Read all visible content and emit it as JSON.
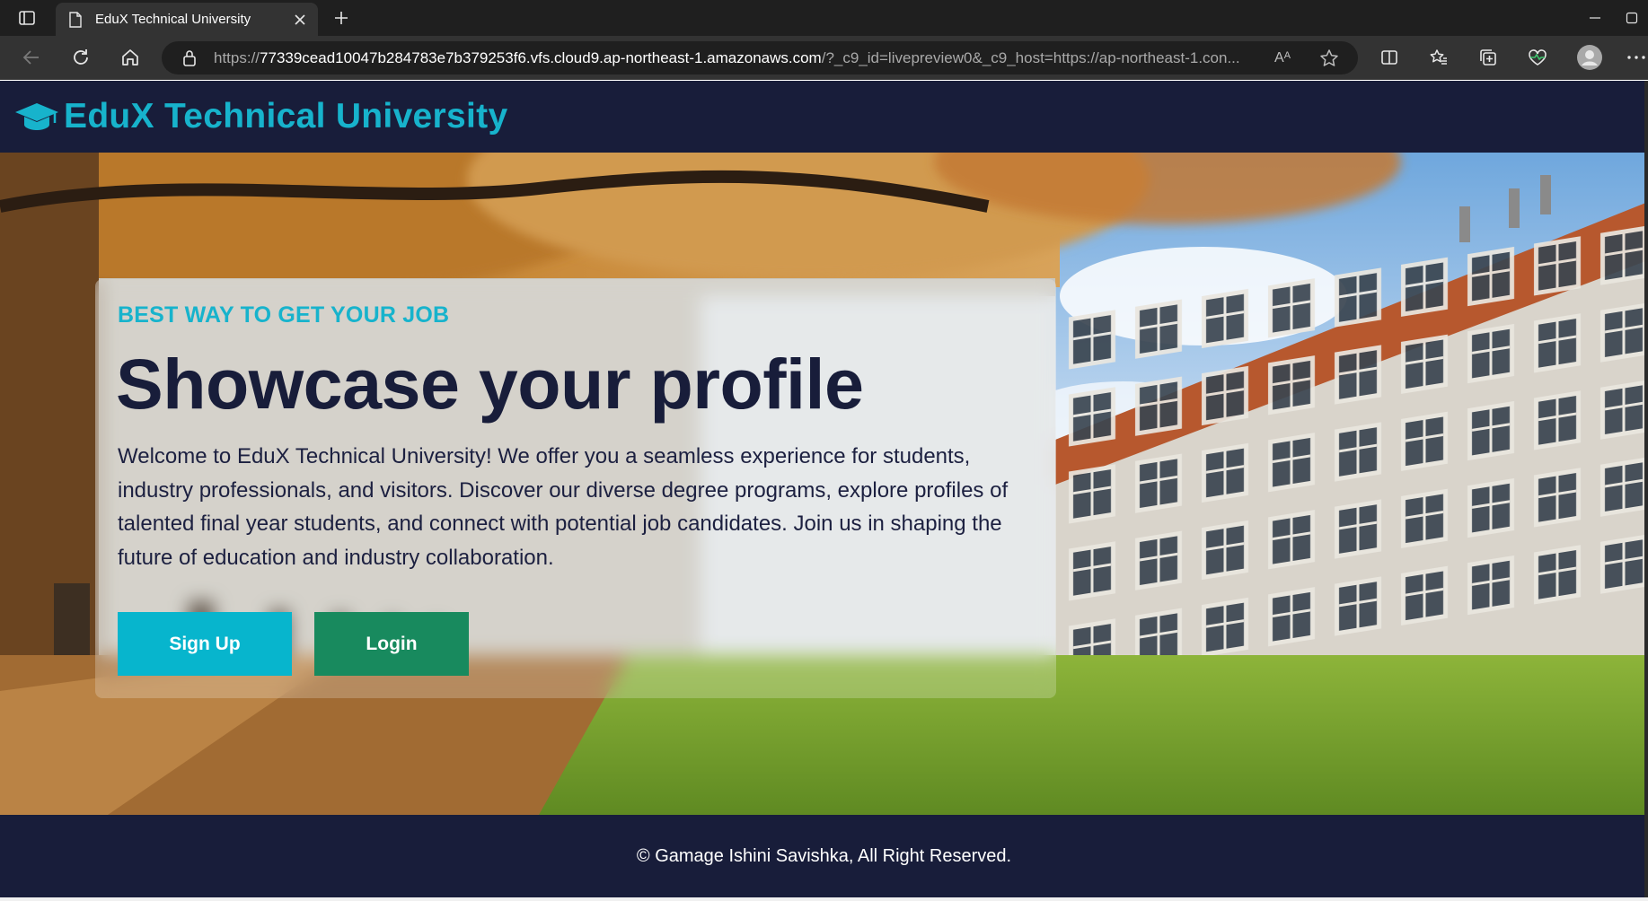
{
  "browser": {
    "tab_title": "EduX Technical University",
    "url_prefix": "https://",
    "url_host": "77339cead10047b284783e7b379253f6.vfs.cloud9.ap-northeast-1.amazonaws.com",
    "url_rest": "/?_c9_id=livepreview0&_c9_host=https://ap-northeast-1.con...",
    "read_aloud_label": "Aᴬ"
  },
  "site": {
    "brand": "EduX Technical University",
    "eyebrow": "BEST WAY TO GET YOUR JOB",
    "title": "Showcase your profile",
    "description": "Welcome to EduX Technical University! We offer you a seamless experience for students, industry professionals, and visitors. Discover our diverse degree programs, explore profiles of talented final year students, and connect with potential job candidates. Join us in shaping the future of education and industry collaboration.",
    "signup_label": "Sign Up",
    "login_label": "Login",
    "footer": "© Gamage Ishini Savishka, All Right Reserved."
  },
  "colors": {
    "navy": "#181d3a",
    "accent": "#17b3cc",
    "signup": "#07b5cd",
    "login": "#188a5e"
  },
  "icons": [
    "tab-actions-icon",
    "document-icon",
    "close-icon",
    "plus-icon",
    "back-icon",
    "refresh-icon",
    "home-icon",
    "lock-icon",
    "read-aloud-icon",
    "favorite-star-icon",
    "split-screen-icon",
    "favorites-icon",
    "collections-icon",
    "performance-icon",
    "profile-icon",
    "more-icon",
    "graduation-cap-icon"
  ]
}
